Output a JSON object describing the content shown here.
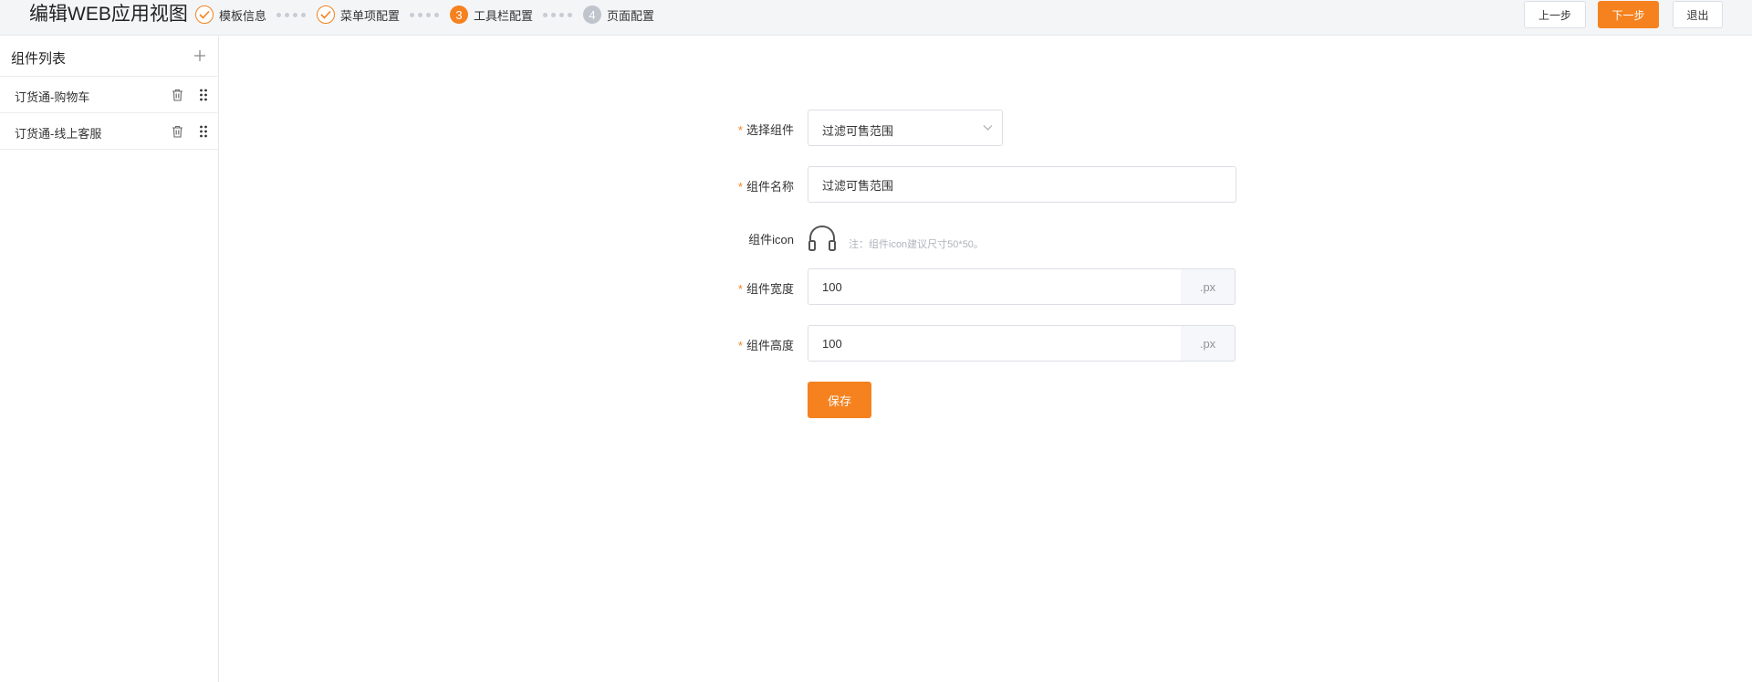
{
  "header": {
    "title": "编辑WEB应用视图",
    "steps": [
      {
        "label": "模板信息",
        "status": "done"
      },
      {
        "label": "菜单项配置",
        "status": "done"
      },
      {
        "number": "3",
        "label": "工具栏配置",
        "status": "active"
      },
      {
        "number": "4",
        "label": "页面配置",
        "status": "pending"
      }
    ],
    "prev_label": "上一步",
    "next_label": "下一步",
    "exit_label": "退出"
  },
  "sidebar": {
    "title": "组件列表",
    "items": [
      {
        "label": "订货通-购物车"
      },
      {
        "label": "订货通-线上客服"
      }
    ]
  },
  "form": {
    "required_mark": "*",
    "select_component": {
      "label": "选择组件",
      "value": "过滤可售范围"
    },
    "component_name": {
      "label": "组件名称",
      "value": "过滤可售范围"
    },
    "component_icon": {
      "label": "组件icon",
      "icon": "headphone-icon",
      "note": "注：组件icon建议尺寸50*50。"
    },
    "component_width": {
      "label": "组件宽度",
      "value": "100",
      "unit": ".px"
    },
    "component_height": {
      "label": "组件高度",
      "value": "100",
      "unit": ".px"
    },
    "save_label": "保存"
  },
  "colors": {
    "accent": "#f5821f",
    "pending_step": "#c0c4cc",
    "border": "#dcdfe6",
    "header_bg": "#f4f5f7"
  }
}
